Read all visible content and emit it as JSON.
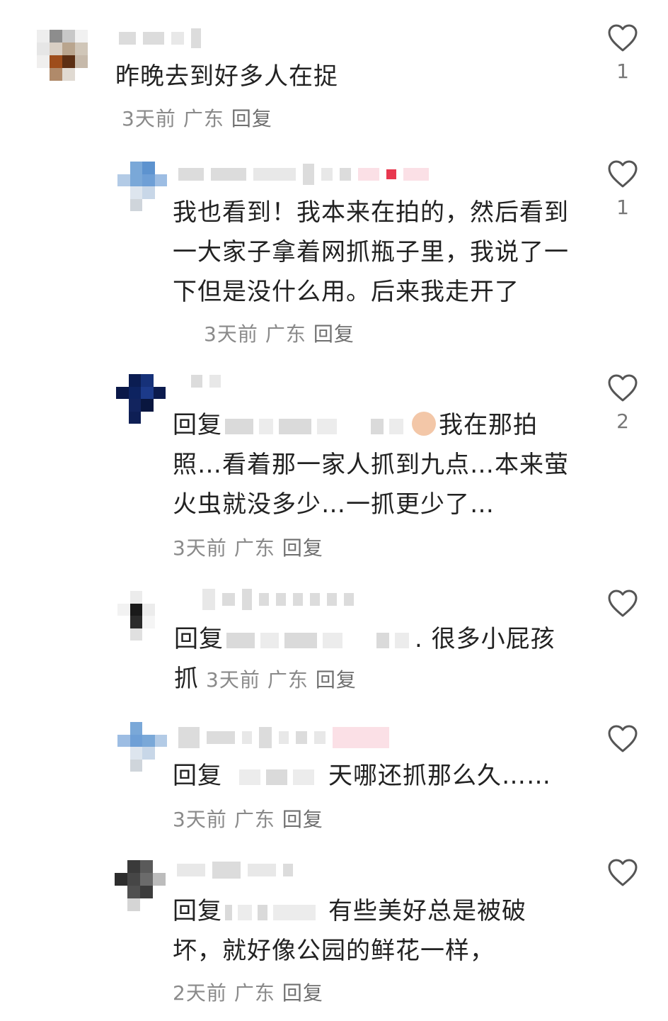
{
  "comments": [
    {
      "text": "昨晚去到好多人在捉",
      "time": "3天前",
      "location": "广东",
      "reply": "回复",
      "likes": "1"
    },
    {
      "text": "我也看到！我本来在拍的，然后看到一大家子拿着网抓瓶子里，我说了一下但是没什么用。后来我走开了",
      "time": "3天前",
      "location": "广东",
      "reply": "回复",
      "likes": "1"
    },
    {
      "prefix": "回复",
      "text_a": "我在那拍",
      "text_b": "照…看着那一家人抓到九点…本来萤",
      "text_c": "火虫就没多少…一抓更少了…",
      "time": "3天前",
      "location": "广东",
      "reply": "回复",
      "likes": "2"
    },
    {
      "prefix": "回复",
      "text_a": ". 很多小屁孩",
      "text_b": "抓",
      "time": "3天前",
      "location": "广东",
      "reply": "回复",
      "likes": ""
    },
    {
      "prefix": "回复",
      "text_a": "天哪还抓那么久……",
      "time": "3天前",
      "location": "广东",
      "reply": "回复",
      "likes": ""
    },
    {
      "prefix": "回复",
      "text_a": "有些美好总是被破",
      "text_b": "坏，就好像公园的鲜花一样，",
      "time": "2天前",
      "location": "广东",
      "reply": "回复",
      "likes": ""
    }
  ],
  "icons": {
    "like": "heart-outline-icon"
  },
  "colors": {
    "text": "#222222",
    "meta": "#8a8a8a",
    "heart": "#555555"
  }
}
